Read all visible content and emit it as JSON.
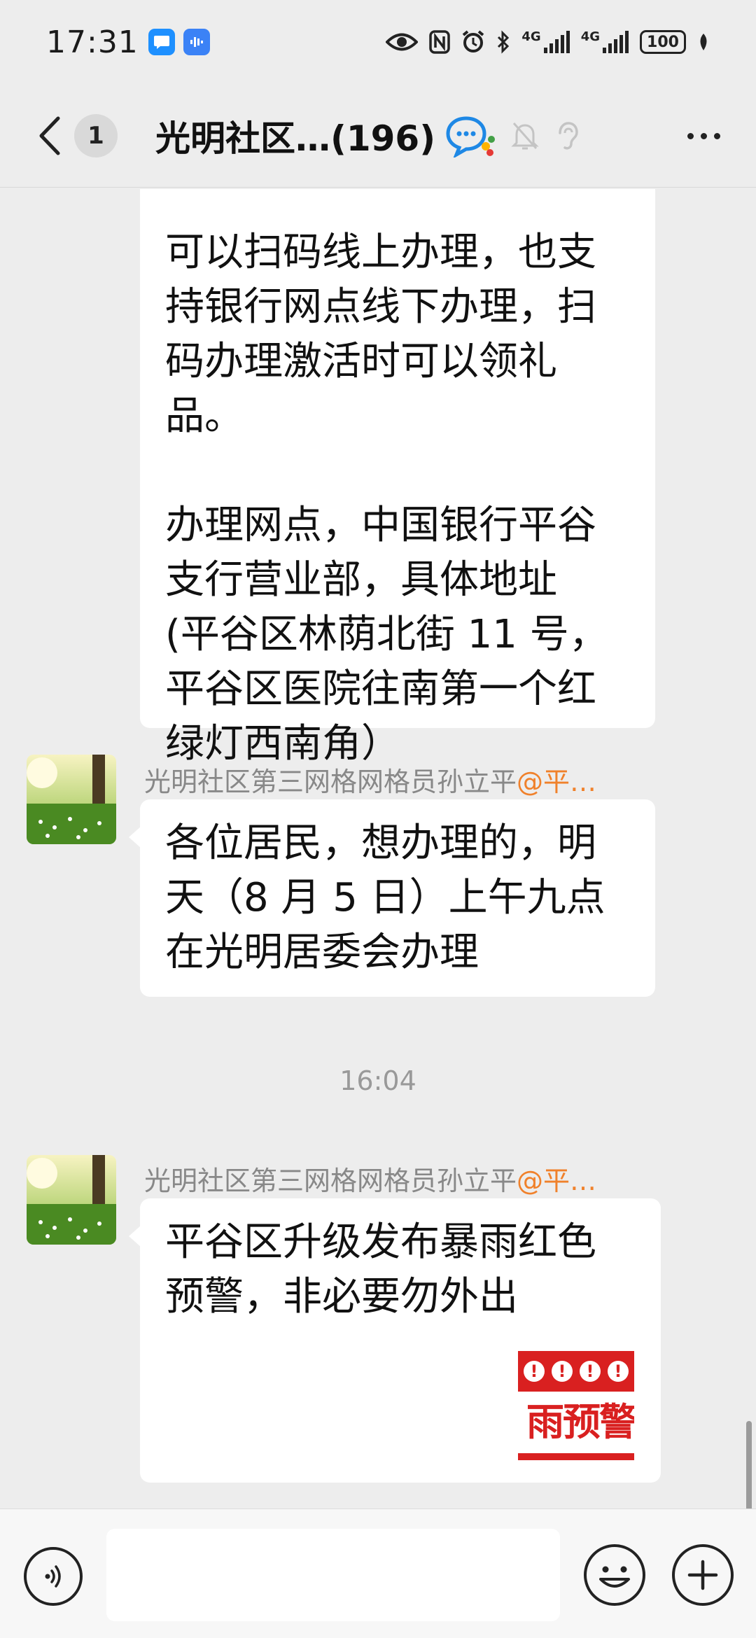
{
  "status_bar": {
    "time": "17:31",
    "network_1": "4G",
    "network_2": "4G",
    "battery": "100"
  },
  "header": {
    "unread_count": "1",
    "title": "光明社区…(196)"
  },
  "messages": [
    {
      "text": "可以扫码线上办理，也支\n持银行网点线下办理，扫\n码办理激活时可以领礼品。\n\n办理网点，中国银行平谷\n支行营业部，具体地址\n(平谷区林荫北街 11 号，\n平谷区医院往南第一个红\n绿灯西南角）"
    },
    {
      "sender": "光明社区第三网格网格员孙立平",
      "mention": "@平…",
      "text": "各位居民，想办理的，明\n天（8 月 5 日）上午九点\n在光明居委会办理"
    },
    {
      "sender": "光明社区第三网格网格员孙立平",
      "mention": "@平…",
      "text": "平谷区升级发布暴雨红色\n预警，非必要勿外出",
      "image_text": "雨预警"
    }
  ],
  "time_separator": "16:04",
  "input": {
    "placeholder": ""
  },
  "colors": {
    "background": "#ededed",
    "bubble": "#ffffff",
    "mention": "#f0812b",
    "warning_red": "#d92020"
  }
}
